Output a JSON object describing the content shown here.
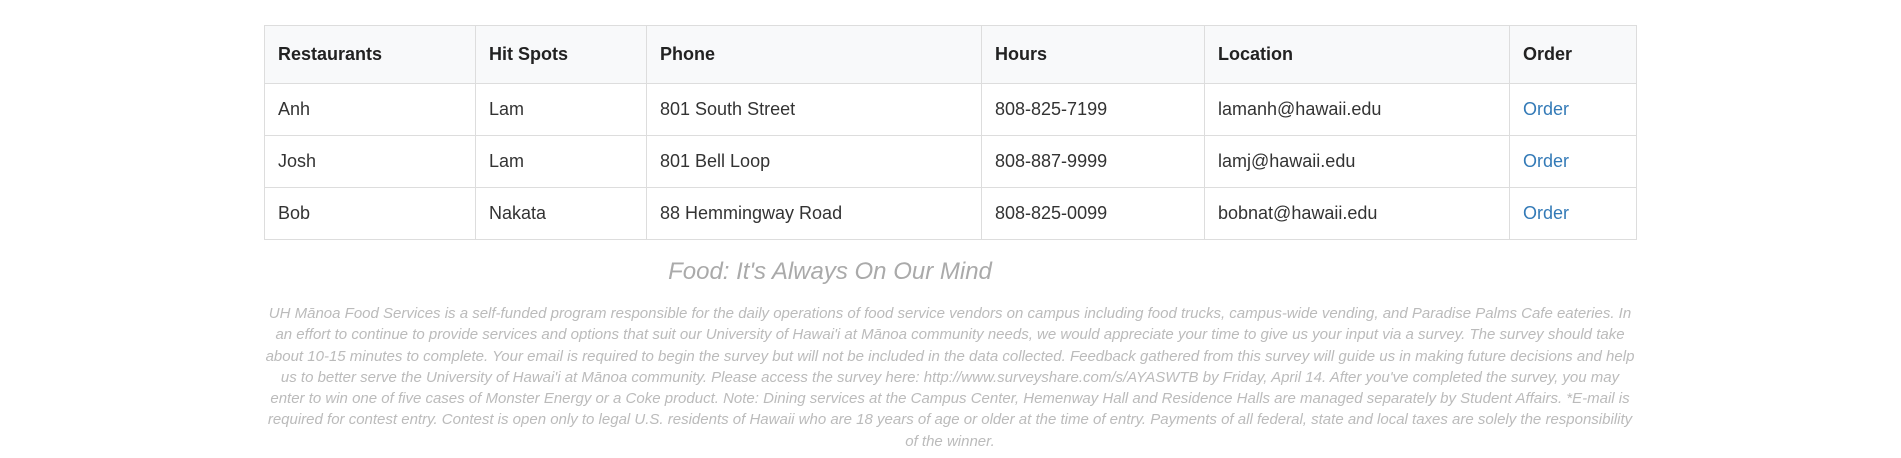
{
  "table": {
    "headers": [
      "Restaurants",
      "Hit Spots",
      "Phone",
      "Hours",
      "Location",
      "Order"
    ],
    "rows": [
      {
        "restaurant": "Anh",
        "hit_spot": "Lam",
        "phone": "801 South Street",
        "hours": "808-825-7199",
        "location": "lamanh@hawaii.edu",
        "order": "Order"
      },
      {
        "restaurant": "Josh",
        "hit_spot": "Lam",
        "phone": "801 Bell Loop",
        "hours": "808-887-9999",
        "location": "lamj@hawaii.edu",
        "order": "Order"
      },
      {
        "restaurant": "Bob",
        "hit_spot": "Nakata",
        "phone": "88 Hemmingway Road",
        "hours": "808-825-0099",
        "location": "bobnat@hawaii.edu",
        "order": "Order"
      }
    ]
  },
  "footer": {
    "tagline": "Food: It's Always On Our Mind",
    "blurb": "UH Mānoa Food Services is a self-funded program responsible for the daily operations of food service vendors on campus including food trucks, campus-wide vending, and Paradise Palms Cafe eateries. In an effort to continue to provide services and options that suit our University of Hawai'i at Mānoa community needs, we would appreciate your time to give us your input via a survey. The survey should take about 10-15 minutes to complete. Your email is required to begin the survey but will not be included in the data collected. Feedback gathered from this survey will guide us in making future decisions and help us to better serve the University of Hawai'i at Mānoa community. Please access the survey here: http://www.surveyshare.com/s/AYASWTB by Friday, April 14. After you've completed the survey, you may enter to win one of five cases of Monster Energy or a Coke product. Note: Dining services at the Campus Center, Hemenway Hall and Residence Halls are managed separately by Student Affairs. *E-mail is required for contest entry. Contest is open only to legal U.S. residents of Hawaii who are 18 years of age or older at the time of entry. Payments of all federal, state and local taxes are solely the responsibility of the winner."
  },
  "colors": {
    "link": "#337ab7",
    "border": "#dddddd",
    "muted_text": "#aaaaaa"
  }
}
